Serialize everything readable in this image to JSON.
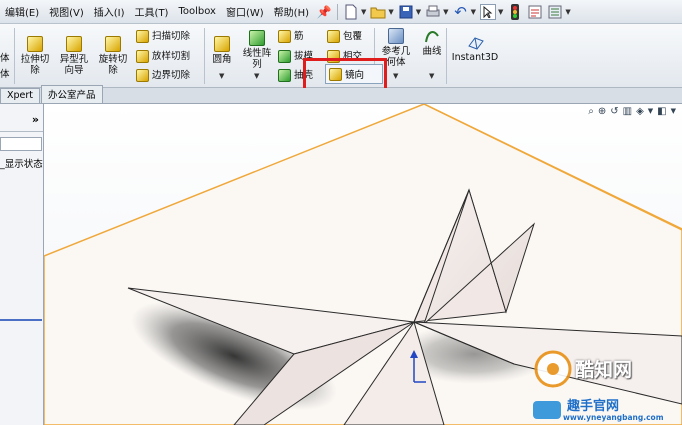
{
  "menu": {
    "items": [
      "编辑(E)",
      "视图(V)",
      "插入(I)",
      "工具(T)",
      "Toolbox",
      "窗口(W)",
      "帮助(H)"
    ]
  },
  "ribbon": {
    "left_cut": [
      "体",
      "体"
    ],
    "extrude_cut": "拉伸切除",
    "hole_wizard": "异型孔向导",
    "revolve_cut": "旋转切除",
    "sweep_cut": "扫描切除",
    "loft_cut": "放样切割",
    "boundary_cut": "边界切除",
    "fillet": "圆角",
    "linear_pattern": "线性阵列",
    "rib": "筋",
    "draft": "拔模",
    "shell": "抽壳",
    "wrap": "包覆",
    "intersect": "相交",
    "mirror": "镜向",
    "ref_geometry": "参考几何体",
    "curves": "曲线",
    "instant3d": "Instant3D"
  },
  "tabs": [
    "Xpert",
    "办公室产品"
  ],
  "left_panel": {
    "collapse": "»",
    "display_state": "_显示状态"
  },
  "watermark": {
    "brand": "酷知网",
    "site_name": "趣手官网",
    "url": "www.yneyangbang.com"
  },
  "colors": {
    "highlight": "#e01d1d",
    "plane_edge": "#f0a83a",
    "star_fill": "#f3ebe8"
  }
}
